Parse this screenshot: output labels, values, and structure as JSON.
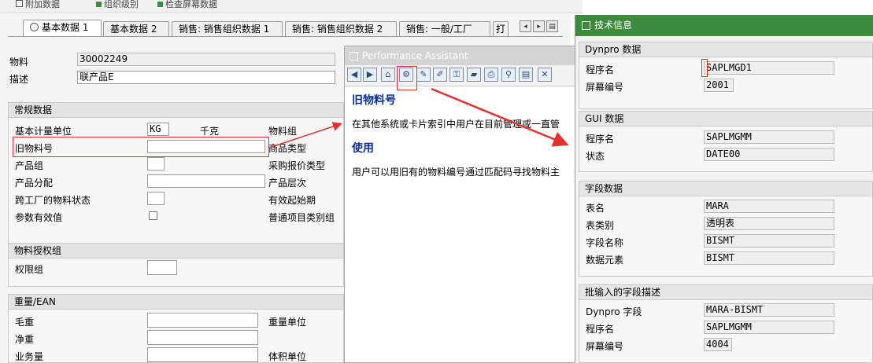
{
  "topbar": {
    "items": [
      "附加数据",
      "组织级别",
      "检查屏幕数据"
    ]
  },
  "tabs": [
    {
      "label": "基本数据 1",
      "active": true
    },
    {
      "label": "基本数据 2"
    },
    {
      "label": "销售: 销售组织数据 1"
    },
    {
      "label": "销售: 销售组织数据 2"
    },
    {
      "label": "销售: 一般/工厂"
    },
    {
      "label": "打"
    }
  ],
  "header": {
    "material_label": "物料",
    "material_value": "30002249",
    "desc_label": "描述",
    "desc_value": "联产品E"
  },
  "general": {
    "title": "常规数据",
    "base_uom_label": "基本计量单位",
    "base_uom_value": "KG",
    "base_uom_text": "千克",
    "matgroup_label": "物料组",
    "old_mat_label": "旧物料号",
    "ext_group_label": "商品类型",
    "division_label": "产品组",
    "purch_val_label": "采购报价类型",
    "prod_alloc_label": "产品分配",
    "prod_hier_label": "产品层次",
    "xplant_status_label": "跨工厂的物料状态",
    "valid_from_label": "有效起始期",
    "config_label": "参数有效值",
    "gen_item_label": "普通项目类别组"
  },
  "auth": {
    "title": "物料授权组",
    "group_label": "权限组"
  },
  "weight": {
    "title": "重量/EAN",
    "gross_label": "毛重",
    "unit_label": "重量单位",
    "net_label": "净重",
    "volume_label": "业务量",
    "vol_unit_label": "体积单位"
  },
  "pa": {
    "title": "Performance Assistant",
    "heading": "旧物料号",
    "text1": "在其他系统或卡片索引中用户在目前管理或一直管",
    "use_heading": "使用",
    "text2": "用户可以用旧有的物料编号通过匹配码寻找物料主"
  },
  "ti": {
    "title": "技术信息",
    "dynpro": {
      "title": "Dynpro 数据",
      "prog_label": "程序名",
      "prog_value": "SAPLMGD1",
      "screen_label": "屏幕编号",
      "screen_value": "2001"
    },
    "gui": {
      "title": "GUI 数据",
      "prog_label": "程序名",
      "prog_value": "SAPLMGMM",
      "status_label": "状态",
      "status_value": "DATE00"
    },
    "field": {
      "title": "字段数据",
      "table_label": "表名",
      "table_value": "MARA",
      "cat_label": "表类别",
      "cat_value": "透明表",
      "fname_label": "字段名称",
      "fname_value": "BISMT",
      "elem_label": "数据元素",
      "elem_value": "BISMT"
    },
    "batch": {
      "title": "批输入的字段描述",
      "dynfield_label": "Dynpro 字段",
      "dynfield_value": "MARA-BISMT",
      "prog_label": "程序名",
      "prog_value": "SAPLMGMM",
      "screen_label": "屏幕编号",
      "screen_value": "4004"
    }
  },
  "colors": {
    "accent_green": "#3c8a3c",
    "highlight_red": "#e53030",
    "help_heading": "#0b2f8f"
  }
}
